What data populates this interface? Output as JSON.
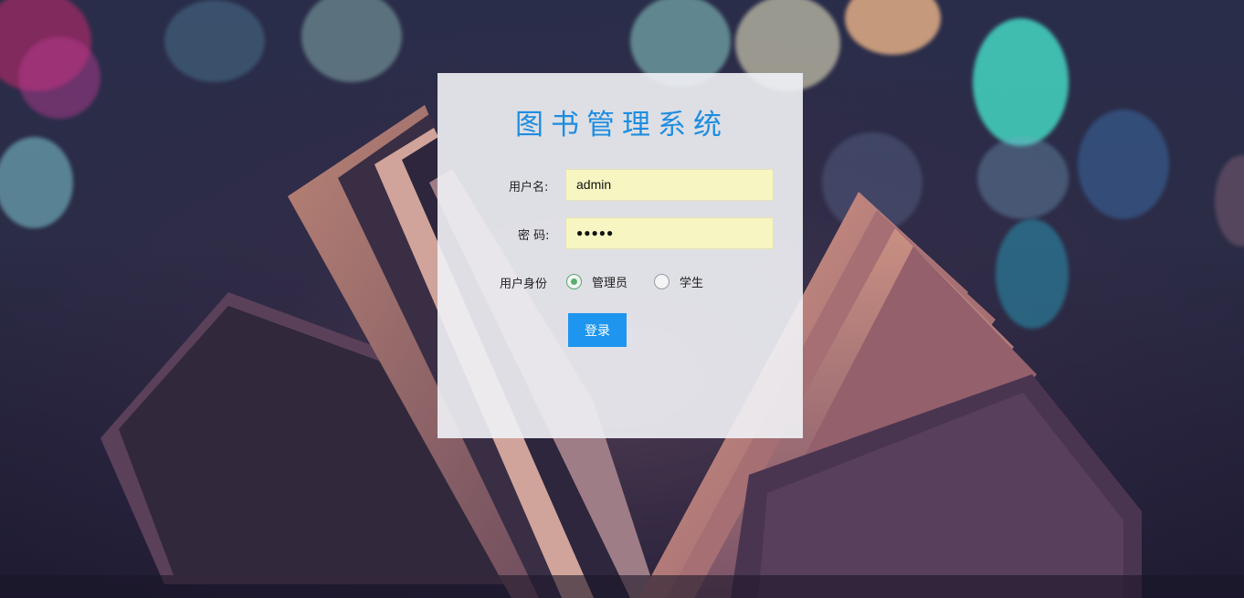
{
  "app": {
    "title": "图书管理系统"
  },
  "form": {
    "username_label": "用户名:",
    "username_value": "admin",
    "password_label": "密 码:",
    "password_value": "●●●●●",
    "role_label": "用户身份",
    "roles": [
      {
        "label": "管理员",
        "selected": true
      },
      {
        "label": "学生",
        "selected": false
      }
    ],
    "login_label": "登录"
  },
  "colors": {
    "accent": "#1d8de0",
    "button": "#1e95ee",
    "autofill": "#f7f6c2",
    "radio_checked": "#5ab06f"
  }
}
